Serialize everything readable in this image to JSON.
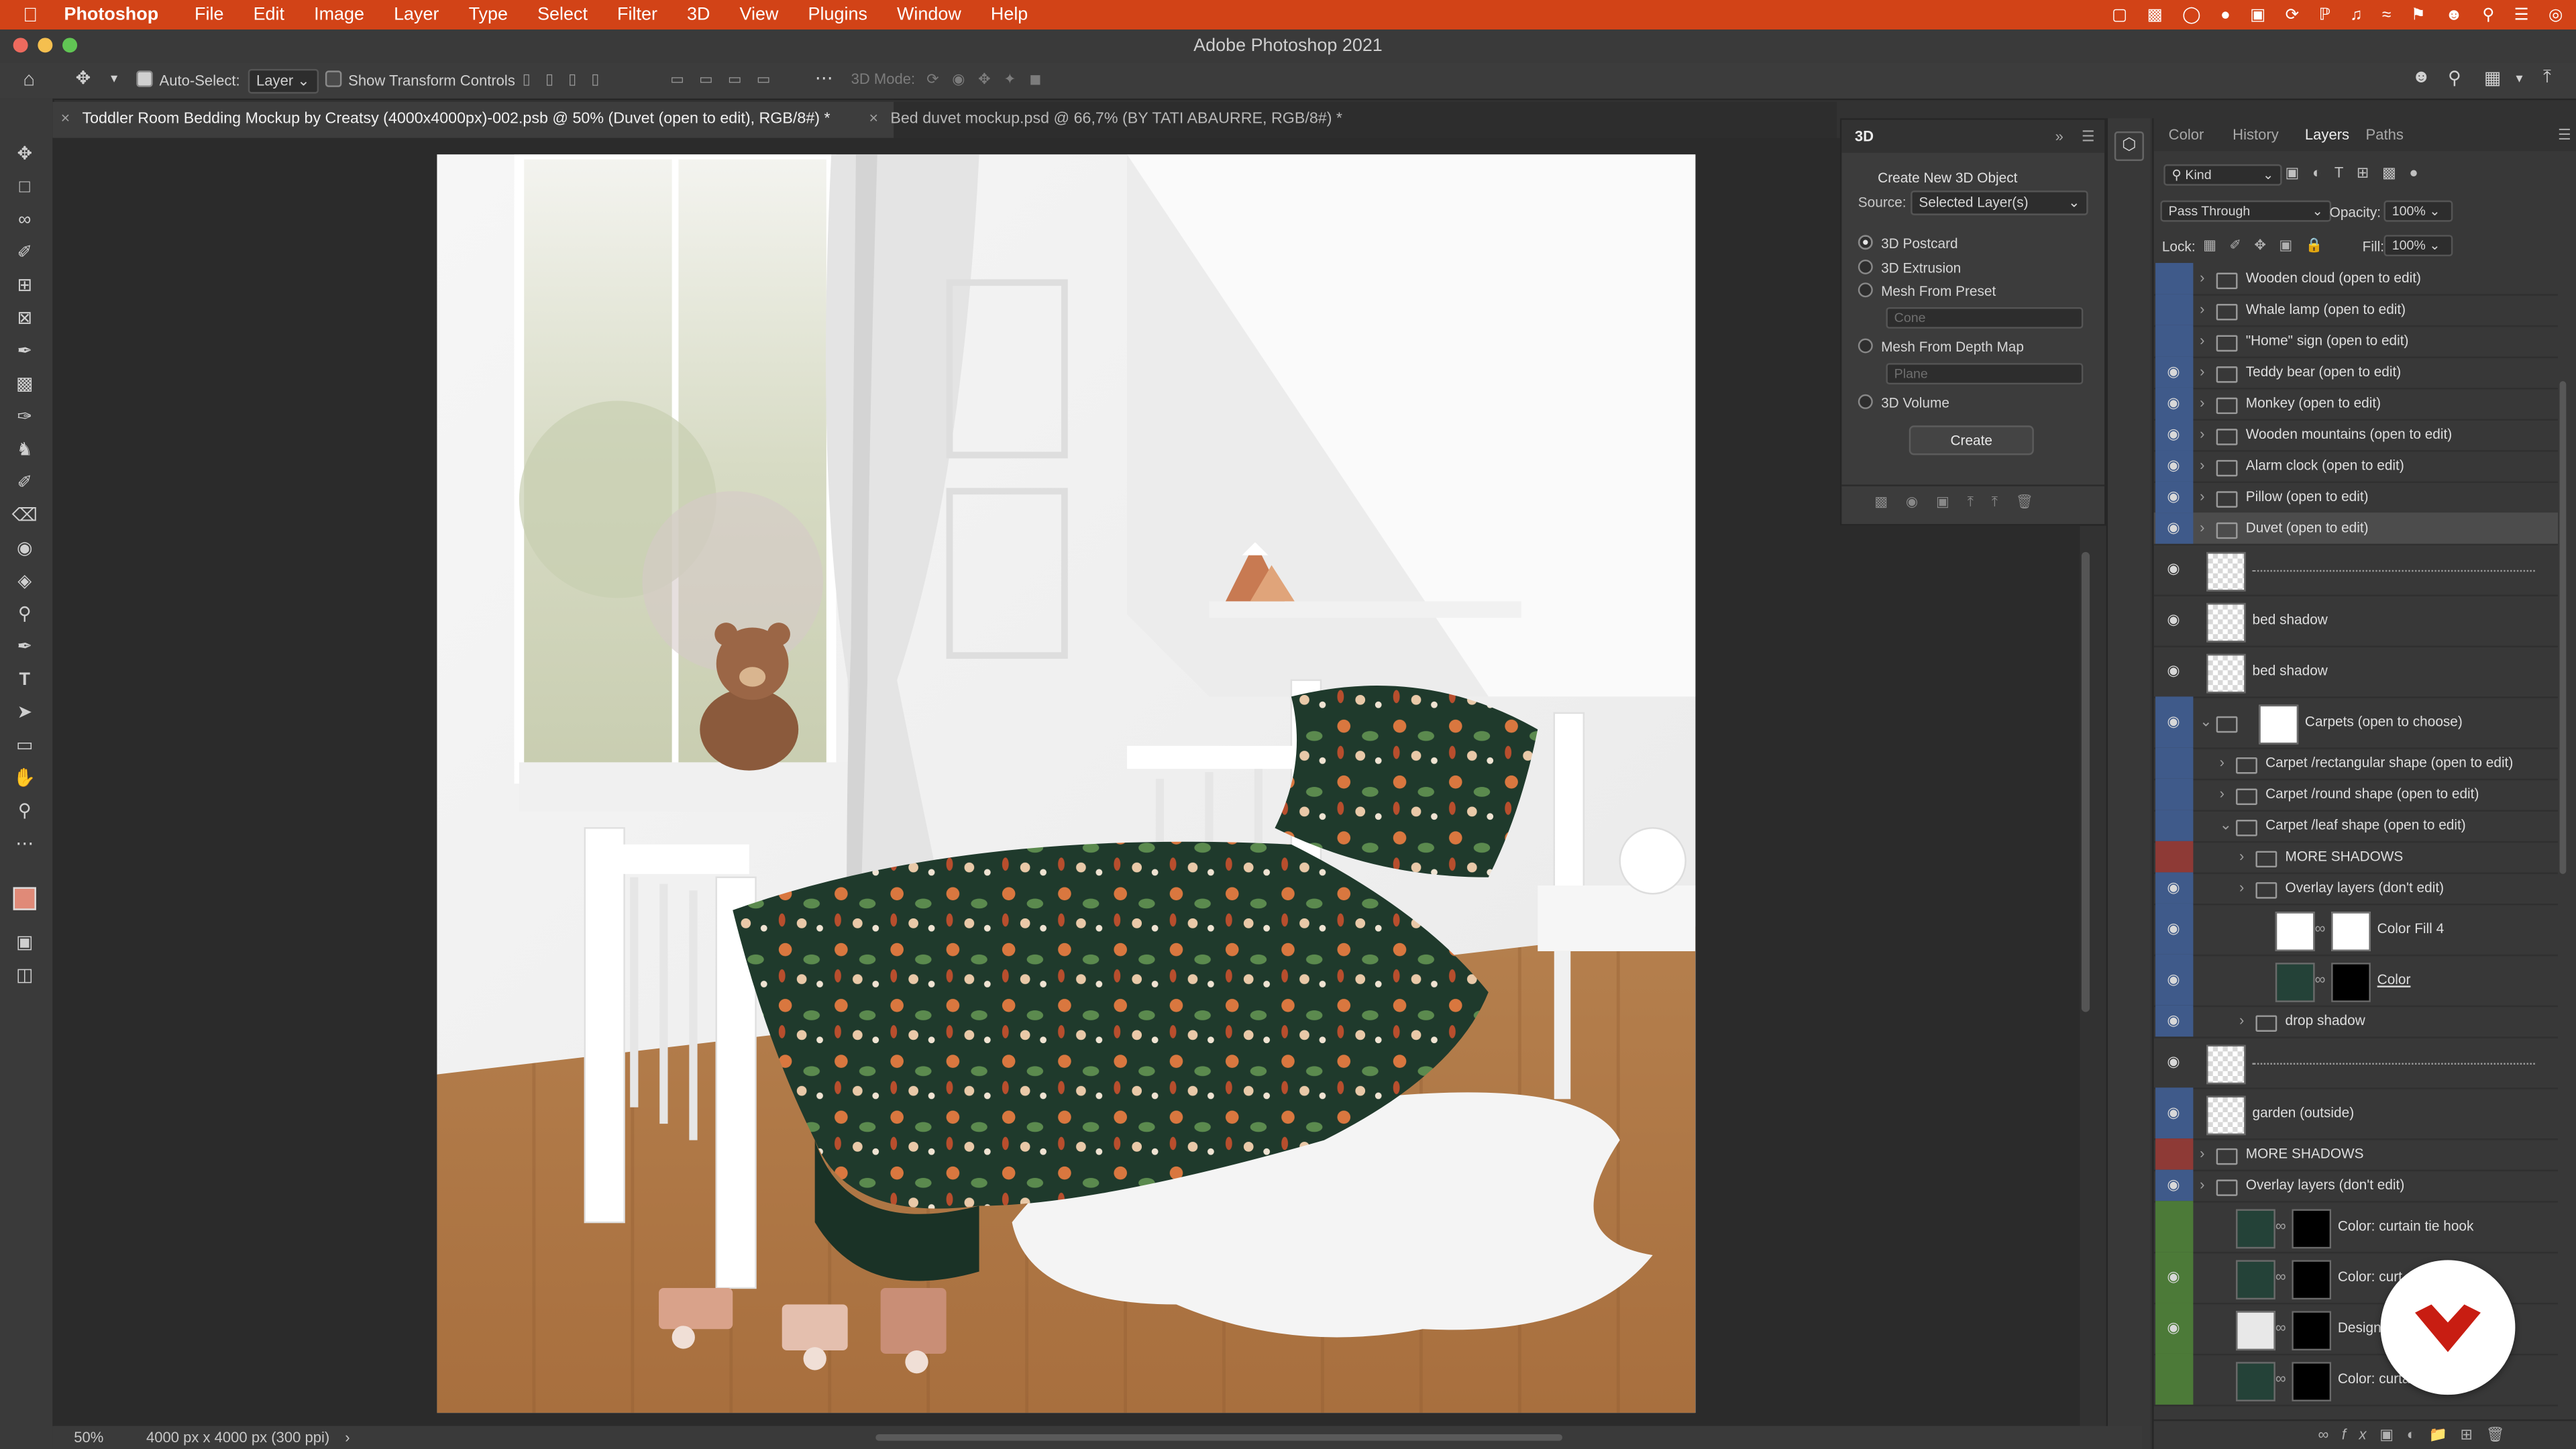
{
  "menubar": {
    "app": "Photoshop",
    "items": [
      "File",
      "Edit",
      "Image",
      "Layer",
      "Type",
      "Select",
      "Filter",
      "3D",
      "View",
      "Plugins",
      "Window",
      "Help"
    ]
  },
  "window": {
    "title": "Adobe Photoshop 2021"
  },
  "options": {
    "auto_select_label": "Auto-Select:",
    "auto_select_value": "Layer",
    "transform_label": "Show Transform Controls",
    "mode_label": "3D Mode:"
  },
  "tabs": [
    {
      "label": "Toddler Room Bedding Mockup by Creatsy (4000x4000px)-002.psb @ 50% (Duvet (open to edit), RGB/8#) *",
      "active": true
    },
    {
      "label": "Bed duvet mockup.psd @ 66,7% (BY TATI ABAURRE, RGB/8#) *",
      "active": false
    }
  ],
  "status": {
    "zoom": "50%",
    "doc_size": "4000 px x 4000 px (300 ppi)"
  },
  "panel3d": {
    "title": "3D",
    "heading": "Create New 3D Object",
    "source_label": "Source:",
    "source_value": "Selected Layer(s)",
    "options": [
      "3D Postcard",
      "3D Extrusion",
      "Mesh From Preset",
      "Mesh From Depth Map",
      "3D Volume"
    ],
    "preset_value": "Cone",
    "depth_value": "Plane",
    "create_label": "Create"
  },
  "layers_panel": {
    "tabs": [
      "Color",
      "History",
      "Layers",
      "Paths"
    ],
    "kind_label": "Kind",
    "blend_mode": "Pass Through",
    "opacity_label": "Opacity:",
    "opacity_value": "100%",
    "lock_label": "Lock:",
    "fill_label": "Fill:",
    "fill_value": "100%",
    "layers": [
      {
        "name": "Wooden cloud (open to edit)",
        "kind": "folder",
        "eye": false,
        "tag": "blue"
      },
      {
        "name": "Whale lamp (open to edit)",
        "kind": "folder",
        "eye": false,
        "tag": "blue"
      },
      {
        "name": "\"Home\" sign (open to edit)",
        "kind": "folder",
        "eye": false,
        "tag": "blue"
      },
      {
        "name": "Teddy bear (open to edit)",
        "kind": "folder",
        "eye": true,
        "tag": "blue"
      },
      {
        "name": "Monkey (open to edit)",
        "kind": "folder",
        "eye": true,
        "tag": "blue"
      },
      {
        "name": "Wooden mountains (open to edit)",
        "kind": "folder",
        "eye": true,
        "tag": "blue"
      },
      {
        "name": "Alarm clock (open to edit)",
        "kind": "folder",
        "eye": true,
        "tag": "blue"
      },
      {
        "name": "Pillow (open to edit)",
        "kind": "folder",
        "eye": true,
        "tag": "blue"
      },
      {
        "name": "Duvet (open to edit)",
        "kind": "folder",
        "eye": true,
        "tag": "blue",
        "selected": true
      },
      {
        "name": "",
        "kind": "divider",
        "eye": true,
        "tag": "none"
      },
      {
        "name": "bed shadow",
        "kind": "pixel",
        "eye": true,
        "tag": "none"
      },
      {
        "name": "bed shadow",
        "kind": "pixel",
        "eye": true,
        "tag": "none"
      },
      {
        "name": "Carpets (open to choose)",
        "kind": "smart",
        "eye": true,
        "tag": "blue"
      },
      {
        "name": "Carpet /rectangular shape (open to edit)",
        "kind": "folder",
        "eye": false,
        "tag": "blue"
      },
      {
        "name": "Carpet /round shape (open to edit)",
        "kind": "folder",
        "eye": false,
        "tag": "blue"
      },
      {
        "name": "Carpet /leaf shape (open to edit)",
        "kind": "folder-open",
        "eye": false,
        "tag": "blue"
      },
      {
        "name": "MORE SHADOWS",
        "kind": "folder",
        "eye": false,
        "tag": "red"
      },
      {
        "name": "Overlay layers (don't edit)",
        "kind": "folder",
        "eye": true,
        "tag": "blue"
      },
      {
        "name": "Color Fill 4",
        "kind": "fill",
        "eye": true,
        "tag": "blue"
      },
      {
        "name": "Color",
        "kind": "color",
        "eye": true,
        "tag": "blue"
      },
      {
        "name": "drop shadow",
        "kind": "folder",
        "eye": true,
        "tag": "blue"
      },
      {
        "name": "",
        "kind": "divider",
        "eye": true,
        "tag": "none"
      },
      {
        "name": "garden (outside)",
        "kind": "pixel",
        "eye": true,
        "tag": "blue"
      },
      {
        "name": "MORE SHADOWS",
        "kind": "folder",
        "eye": false,
        "tag": "red"
      },
      {
        "name": "Overlay layers (don't edit)",
        "kind": "folder",
        "eye": true,
        "tag": "blue"
      },
      {
        "name": "Color: curtain tie hook",
        "kind": "color",
        "eye": false,
        "tag": "green"
      },
      {
        "name": "Color: curt",
        "kind": "color",
        "eye": true,
        "tag": "green"
      },
      {
        "name": "Design: c",
        "kind": "design",
        "eye": true,
        "tag": "green"
      },
      {
        "name": "Color: curtain tie",
        "kind": "color",
        "eye": false,
        "tag": "green"
      }
    ]
  },
  "colors": {
    "accent": "#d24317",
    "blue_tag": "#3f5a8a",
    "red_tag": "#8e3a36",
    "green_tag": "#4c7a38"
  }
}
